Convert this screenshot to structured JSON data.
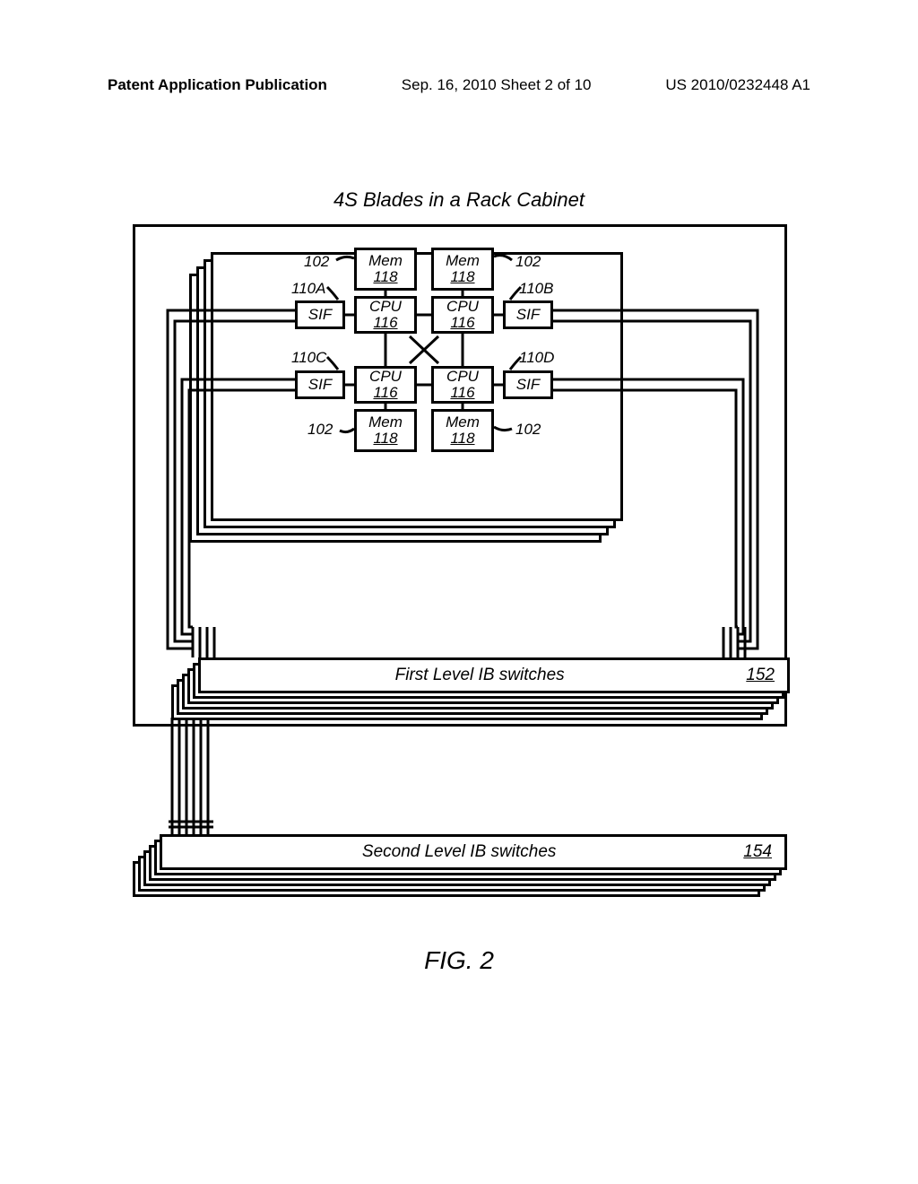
{
  "header": {
    "left": "Patent Application Publication",
    "mid": "Sep. 16, 2010  Sheet 2 of 10",
    "right": "US 2010/0232448 A1"
  },
  "title": "4S Blades in a Rack Cabinet",
  "labels": {
    "mem": "Mem",
    "mem_ref": "118",
    "cpu": "CPU",
    "cpu_ref": "116",
    "sif": "SIF"
  },
  "refs": {
    "r102": "102",
    "r110a": "110A",
    "r110b": "110B",
    "r110c": "110C",
    "r110d": "110D"
  },
  "switches": {
    "first": "First Level IB switches",
    "first_ref": "152",
    "second": "Second Level IB switches",
    "second_ref": "154"
  },
  "fig": "FIG. 2"
}
